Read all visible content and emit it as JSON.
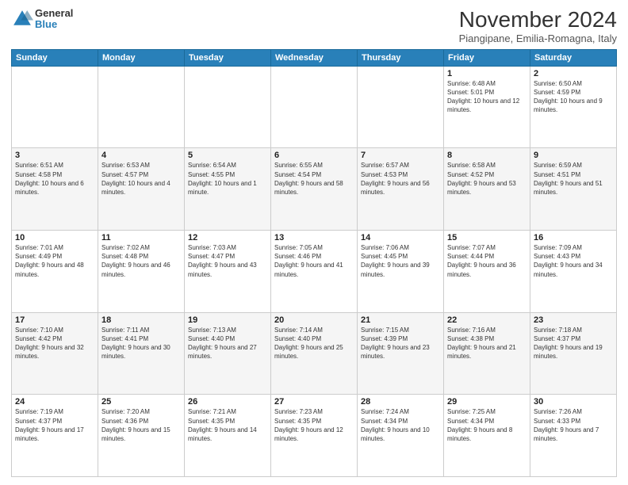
{
  "logo": {
    "general": "General",
    "blue": "Blue"
  },
  "title": "November 2024",
  "location": "Piangipane, Emilia-Romagna, Italy",
  "headers": [
    "Sunday",
    "Monday",
    "Tuesday",
    "Wednesday",
    "Thursday",
    "Friday",
    "Saturday"
  ],
  "rows": [
    [
      {
        "day": "",
        "info": ""
      },
      {
        "day": "",
        "info": ""
      },
      {
        "day": "",
        "info": ""
      },
      {
        "day": "",
        "info": ""
      },
      {
        "day": "",
        "info": ""
      },
      {
        "day": "1",
        "info": "Sunrise: 6:48 AM\nSunset: 5:01 PM\nDaylight: 10 hours and 12 minutes."
      },
      {
        "day": "2",
        "info": "Sunrise: 6:50 AM\nSunset: 4:59 PM\nDaylight: 10 hours and 9 minutes."
      }
    ],
    [
      {
        "day": "3",
        "info": "Sunrise: 6:51 AM\nSunset: 4:58 PM\nDaylight: 10 hours and 6 minutes."
      },
      {
        "day": "4",
        "info": "Sunrise: 6:53 AM\nSunset: 4:57 PM\nDaylight: 10 hours and 4 minutes."
      },
      {
        "day": "5",
        "info": "Sunrise: 6:54 AM\nSunset: 4:55 PM\nDaylight: 10 hours and 1 minute."
      },
      {
        "day": "6",
        "info": "Sunrise: 6:55 AM\nSunset: 4:54 PM\nDaylight: 9 hours and 58 minutes."
      },
      {
        "day": "7",
        "info": "Sunrise: 6:57 AM\nSunset: 4:53 PM\nDaylight: 9 hours and 56 minutes."
      },
      {
        "day": "8",
        "info": "Sunrise: 6:58 AM\nSunset: 4:52 PM\nDaylight: 9 hours and 53 minutes."
      },
      {
        "day": "9",
        "info": "Sunrise: 6:59 AM\nSunset: 4:51 PM\nDaylight: 9 hours and 51 minutes."
      }
    ],
    [
      {
        "day": "10",
        "info": "Sunrise: 7:01 AM\nSunset: 4:49 PM\nDaylight: 9 hours and 48 minutes."
      },
      {
        "day": "11",
        "info": "Sunrise: 7:02 AM\nSunset: 4:48 PM\nDaylight: 9 hours and 46 minutes."
      },
      {
        "day": "12",
        "info": "Sunrise: 7:03 AM\nSunset: 4:47 PM\nDaylight: 9 hours and 43 minutes."
      },
      {
        "day": "13",
        "info": "Sunrise: 7:05 AM\nSunset: 4:46 PM\nDaylight: 9 hours and 41 minutes."
      },
      {
        "day": "14",
        "info": "Sunrise: 7:06 AM\nSunset: 4:45 PM\nDaylight: 9 hours and 39 minutes."
      },
      {
        "day": "15",
        "info": "Sunrise: 7:07 AM\nSunset: 4:44 PM\nDaylight: 9 hours and 36 minutes."
      },
      {
        "day": "16",
        "info": "Sunrise: 7:09 AM\nSunset: 4:43 PM\nDaylight: 9 hours and 34 minutes."
      }
    ],
    [
      {
        "day": "17",
        "info": "Sunrise: 7:10 AM\nSunset: 4:42 PM\nDaylight: 9 hours and 32 minutes."
      },
      {
        "day": "18",
        "info": "Sunrise: 7:11 AM\nSunset: 4:41 PM\nDaylight: 9 hours and 30 minutes."
      },
      {
        "day": "19",
        "info": "Sunrise: 7:13 AM\nSunset: 4:40 PM\nDaylight: 9 hours and 27 minutes."
      },
      {
        "day": "20",
        "info": "Sunrise: 7:14 AM\nSunset: 4:40 PM\nDaylight: 9 hours and 25 minutes."
      },
      {
        "day": "21",
        "info": "Sunrise: 7:15 AM\nSunset: 4:39 PM\nDaylight: 9 hours and 23 minutes."
      },
      {
        "day": "22",
        "info": "Sunrise: 7:16 AM\nSunset: 4:38 PM\nDaylight: 9 hours and 21 minutes."
      },
      {
        "day": "23",
        "info": "Sunrise: 7:18 AM\nSunset: 4:37 PM\nDaylight: 9 hours and 19 minutes."
      }
    ],
    [
      {
        "day": "24",
        "info": "Sunrise: 7:19 AM\nSunset: 4:37 PM\nDaylight: 9 hours and 17 minutes."
      },
      {
        "day": "25",
        "info": "Sunrise: 7:20 AM\nSunset: 4:36 PM\nDaylight: 9 hours and 15 minutes."
      },
      {
        "day": "26",
        "info": "Sunrise: 7:21 AM\nSunset: 4:35 PM\nDaylight: 9 hours and 14 minutes."
      },
      {
        "day": "27",
        "info": "Sunrise: 7:23 AM\nSunset: 4:35 PM\nDaylight: 9 hours and 12 minutes."
      },
      {
        "day": "28",
        "info": "Sunrise: 7:24 AM\nSunset: 4:34 PM\nDaylight: 9 hours and 10 minutes."
      },
      {
        "day": "29",
        "info": "Sunrise: 7:25 AM\nSunset: 4:34 PM\nDaylight: 9 hours and 8 minutes."
      },
      {
        "day": "30",
        "info": "Sunrise: 7:26 AM\nSunset: 4:33 PM\nDaylight: 9 hours and 7 minutes."
      }
    ]
  ]
}
